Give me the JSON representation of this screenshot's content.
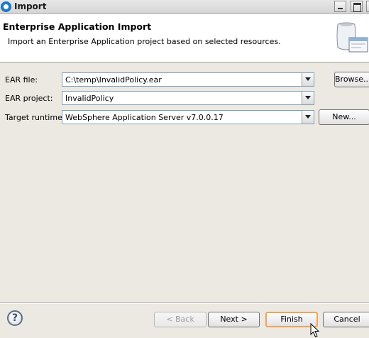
{
  "window": {
    "title": "Import"
  },
  "header": {
    "title": "Enterprise Application Import",
    "description": "Import an Enterprise Application project based on selected resources."
  },
  "form": {
    "ear_file": {
      "label": "EAR file:",
      "value": "C:\\temp\\InvalidPolicy.ear",
      "button": "Browse..."
    },
    "ear_project": {
      "label": "EAR project:",
      "value": "InvalidPolicy"
    },
    "target_runtime": {
      "label": "Target runtime:",
      "value": "WebSphere Application Server v7.0.0.17",
      "button": "New..."
    }
  },
  "footer": {
    "help": "?",
    "back": "< Back",
    "next": "Next >",
    "finish": "Finish",
    "cancel": "Cancel"
  },
  "icons": [
    "app-icon",
    "minimize-icon",
    "maximize-icon",
    "wizard-banner-icon",
    "help-icon",
    "mouse-cursor-icon"
  ]
}
